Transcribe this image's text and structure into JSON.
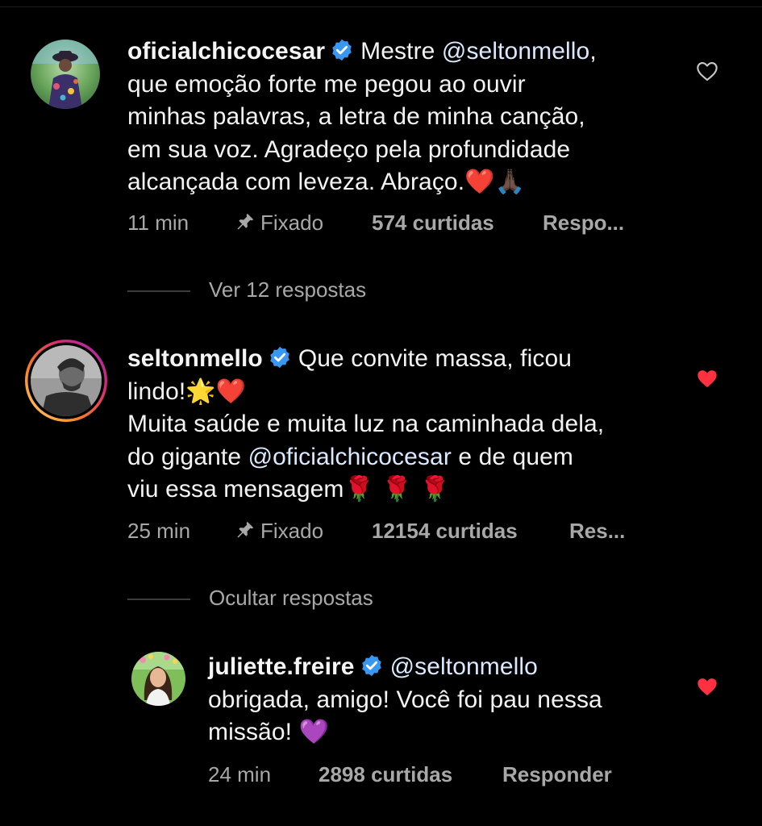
{
  "comments": [
    {
      "username": "oficialchicocesar",
      "text_lines": [
        "Mestre @seltonmello,",
        "que emoção forte me pegou ao ouvir",
        "minhas palavras, a letra de minha canção,",
        "em sua voz. Agradeço pela profundidade",
        "alcançada com leveza. Abraço."
      ],
      "first_line_prefix": "Mestre ",
      "first_line_mention": "@seltonmello",
      "first_line_suffix": ",",
      "line2": "que emoção forte me pegou ao ouvir",
      "line3": "minhas palavras, a letra de minha canção,",
      "line4": "em sua voz. Agradeço pela profundidade",
      "line5": "alcançada com leveza. Abraço.",
      "line5_emoji": "❤️🙏🏿",
      "time": "11 min",
      "pinned_label": "Fixado",
      "likes": "574 curtidas",
      "reply_label": "Respo...",
      "liked": false,
      "replies_toggle": "Ver 12 respostas"
    },
    {
      "username": "seltonmello",
      "line1_text": "Que convite massa, ficou",
      "line2_text": "lindo!",
      "line2_emoji": "🌟❤️",
      "line3": "Muita saúde e muita luz na caminhada dela,",
      "line4_prefix": "do gigante ",
      "line4_mention": "@oficialchicocesar",
      "line4_suffix": " e de quem",
      "line5": "viu essa mensagem",
      "line5_emoji": "🌹 🌹 🌹",
      "time": "25 min",
      "pinned_label": "Fixado",
      "likes": "12154 curtidas",
      "reply_label": "Res...",
      "liked": true,
      "replies_toggle": "Ocultar respostas"
    },
    {
      "username": "juliette.freire",
      "line1_mention": "@seltonmello",
      "line2": "obrigada, amigo! Você foi pau nessa",
      "line3": "missão!",
      "line3_emoji": "💜",
      "time": "24 min",
      "likes": "2898 curtidas",
      "reply_label": "Responder",
      "liked": true
    }
  ],
  "icons": {
    "verified": "verified-badge-icon",
    "heart_outline": "heart-outline-icon",
    "heart_filled": "heart-filled-icon",
    "pin": "pin-icon"
  },
  "colors": {
    "background": "#000000",
    "verified_blue": "#3897f0",
    "heart_red": "#ff3040",
    "meta_gray": "#a8a8a8",
    "story_ring_start": "#f58529",
    "story_ring_end": "#dd2a7b"
  }
}
